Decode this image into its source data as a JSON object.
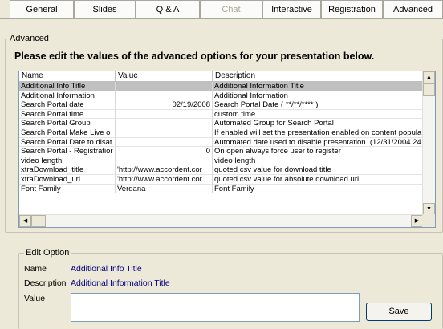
{
  "tabs": [
    {
      "label": "General",
      "disabled": false
    },
    {
      "label": "Slides",
      "disabled": false
    },
    {
      "label": "Q & A",
      "disabled": false
    },
    {
      "label": "Chat",
      "disabled": true
    },
    {
      "label": "Interactive",
      "disabled": false
    },
    {
      "label": "Registration",
      "disabled": false
    },
    {
      "label": "Advanced",
      "disabled": false
    }
  ],
  "advanced_group": {
    "legend": "Advanced",
    "heading": "Please edit the values of the advanced options for your presentation below."
  },
  "grid": {
    "columns": [
      "Name",
      "Value",
      "Description"
    ],
    "rows": [
      {
        "name": "Additional Info Title",
        "value": "",
        "description": "Additional Information Title",
        "selected": true
      },
      {
        "name": "Additional Information",
        "value": "",
        "description": "Additional Information",
        "selected": false
      },
      {
        "name": "Search Portal date",
        "value": "02/19/2008",
        "description": "Search Portal Date ( **/**/**** )",
        "selected": false
      },
      {
        "name": "Search Portal time",
        "value": "",
        "description": "custom time",
        "selected": false
      },
      {
        "name": "Search Portal Group",
        "value": "",
        "description": "Automated Group for Search Portal",
        "selected": false
      },
      {
        "name": "Search Portal Make Live o",
        "value": "",
        "description": "If enabled will set the presentation enabled on content popula",
        "selected": false
      },
      {
        "name": "Search Portal Date to disat",
        "value": "",
        "description": "Automated date used to disable presentation. (12/31/2004 24",
        "selected": false
      },
      {
        "name": "Search Portal - Registratior",
        "value": "0",
        "description": "On open always force user to register",
        "selected": false
      },
      {
        "name": "video length",
        "value": "",
        "description": "video length",
        "selected": false
      },
      {
        "name": "xtraDownload_title",
        "value": "'http://www.accordent.cor",
        "description": "quoted csv value for download title",
        "selected": false
      },
      {
        "name": "xtraDownload_url",
        "value": "'http://www.accordent.cor",
        "description": "quoted csv value for absolute download url",
        "selected": false
      },
      {
        "name": "Font Family",
        "value": "Verdana",
        "description": "Font Family",
        "selected": false
      }
    ]
  },
  "edit_option": {
    "legend": "Edit Option",
    "name_label": "Name",
    "name_value": "Additional Info Title",
    "description_label": "Description",
    "description_value": "Additional Information Title",
    "value_label": "Value",
    "value_text": "",
    "save_label": "Save"
  },
  "colors": {
    "background": "#ece9d8",
    "selected_row": "#c0c0c0",
    "link_value": "#00007f"
  }
}
